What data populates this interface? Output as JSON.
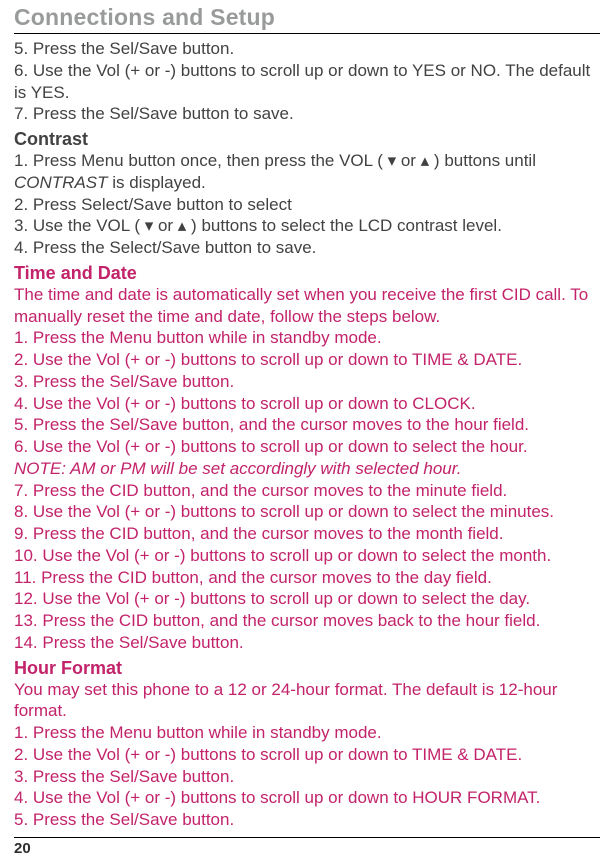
{
  "header": {
    "title": "Connections and Setup"
  },
  "section_a": {
    "lines": [
      "5. Press the Sel/Save button.",
      "6. Use the Vol (+ or -) buttons to scroll up or down to YES or NO. The default is YES.",
      "7. Press the Sel/Save button to save."
    ]
  },
  "contrast": {
    "heading": "Contrast",
    "lines": [
      "1. Press Menu button once, then press the VOL ( ▾ or ▴ ) buttons until",
      "CONTRAST is displayed.",
      "2. Press Select/Save button to select",
      "3. Use the VOL ( ▾ or ▴ ) buttons to select the LCD contrast level.",
      "4. Press the Select/Save button to save."
    ]
  },
  "time_date": {
    "heading": "Time and Date",
    "lines": [
      "The time and date is automatically set when you receive the first CID call. To manually reset the time and date, follow the steps below.",
      "1. Press the Menu button while in standby mode.",
      "2. Use the Vol (+ or -) buttons to scroll up or down to TIME & DATE.",
      "3. Press the Sel/Save button.",
      "4. Use the Vol (+ or -) buttons to scroll up or down to CLOCK.",
      "5. Press the Sel/Save button, and the cursor moves to the hour field.",
      "6. Use the Vol (+ or -) buttons to scroll up or down to select the hour."
    ],
    "note": "NOTE: AM or PM will be set accordingly with selected hour.",
    "lines2": [
      "7. Press the CID button, and the cursor moves to the minute field.",
      "8. Use the Vol (+ or -) buttons to scroll up or down to select the minutes.",
      "9. Press the CID button, and the cursor moves to the month field.",
      "10. Use the Vol (+ or -) buttons to scroll up or down to select the month.",
      "11. Press the CID button, and the cursor moves to the day field.",
      "12. Use the Vol (+ or -) buttons to scroll up or down to select the day.",
      "13. Press the CID button, and the cursor moves back to the hour field.",
      "14. Press the Sel/Save button."
    ]
  },
  "hour_format": {
    "heading": "Hour Format",
    "lines": [
      "You may set this phone to a 12 or 24-hour format. The default is 12-hour format.",
      "1. Press the Menu button while in standby mode.",
      "2. Use the Vol (+ or -) buttons to scroll up or down to TIME & DATE.",
      "3. Press the Sel/Save button.",
      "4. Use the Vol (+ or -) buttons to scroll up or down to HOUR FORMAT.",
      "5. Press the Sel/Save button."
    ]
  },
  "page_number": "20"
}
